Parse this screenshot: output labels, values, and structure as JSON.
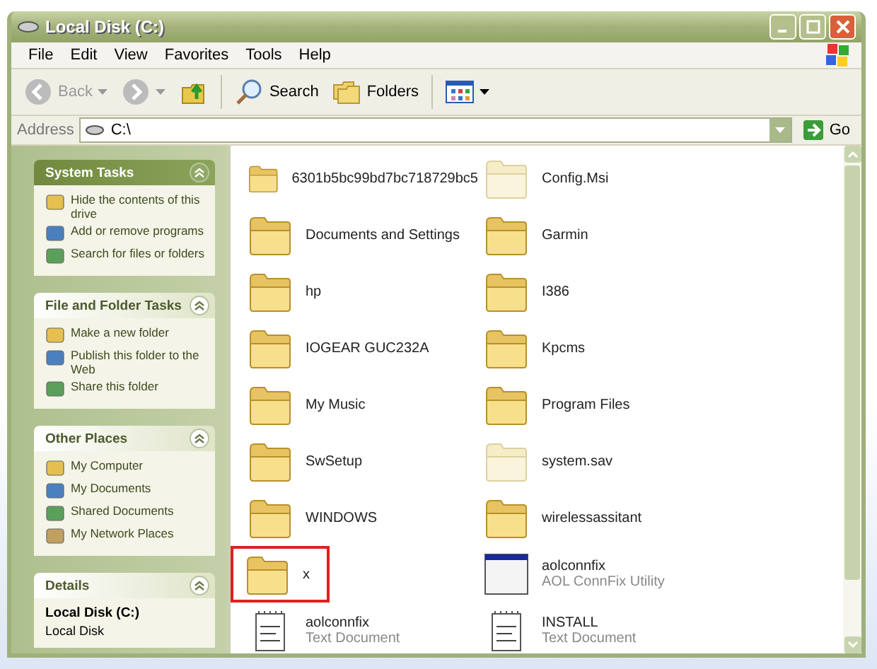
{
  "window": {
    "title": "Local Disk (C:)"
  },
  "menu": [
    "File",
    "Edit",
    "View",
    "Favorites",
    "Tools",
    "Help"
  ],
  "toolbar": {
    "back": {
      "label": "Back",
      "disabled": true
    },
    "forward": {
      "disabled": true
    },
    "search": "Search",
    "folders": "Folders"
  },
  "address": {
    "label": "Address",
    "value": "C:\\",
    "go": "Go"
  },
  "sidebar": [
    {
      "title": "System Tasks",
      "primary": true,
      "kind": "links",
      "links": [
        "Hide the contents of this drive",
        "Add or remove programs",
        "Search for files or folders"
      ]
    },
    {
      "title": "File and Folder Tasks",
      "primary": false,
      "kind": "links",
      "links": [
        "Make a new folder",
        "Publish this folder to the Web",
        "Share this folder"
      ]
    },
    {
      "title": "Other Places",
      "primary": false,
      "kind": "links",
      "links": [
        "My Computer",
        "My Documents",
        "Shared Documents",
        "My Network Places"
      ]
    },
    {
      "title": "Details",
      "primary": false,
      "kind": "details",
      "name": "Local Disk (C:)",
      "type": "Local Disk"
    }
  ],
  "files": [
    {
      "name": "6301b5bc99bd7bc718729bc5",
      "kind": "folder",
      "hidden": false,
      "highlighted": false
    },
    {
      "name": "Config.Msi",
      "kind": "folder",
      "hidden": true,
      "highlighted": false
    },
    {
      "name": "Documents and Settings",
      "kind": "folder",
      "hidden": false,
      "highlighted": false
    },
    {
      "name": "Garmin",
      "kind": "folder",
      "hidden": false,
      "highlighted": false
    },
    {
      "name": "hp",
      "kind": "folder",
      "hidden": false,
      "highlighted": false
    },
    {
      "name": "I386",
      "kind": "folder",
      "hidden": false,
      "highlighted": false
    },
    {
      "name": "IOGEAR GUC232A",
      "kind": "folder",
      "hidden": false,
      "highlighted": false
    },
    {
      "name": "Kpcms",
      "kind": "folder",
      "hidden": false,
      "highlighted": false
    },
    {
      "name": "My Music",
      "kind": "folder",
      "hidden": false,
      "highlighted": false
    },
    {
      "name": "Program Files",
      "kind": "folder",
      "hidden": false,
      "highlighted": false
    },
    {
      "name": "SwSetup",
      "kind": "folder",
      "hidden": false,
      "highlighted": false
    },
    {
      "name": "system.sav",
      "kind": "folder",
      "hidden": true,
      "highlighted": false
    },
    {
      "name": "WINDOWS",
      "kind": "folder",
      "hidden": false,
      "highlighted": false
    },
    {
      "name": "wirelessassitant",
      "kind": "folder",
      "hidden": false,
      "highlighted": false
    },
    {
      "name": "x",
      "kind": "folder",
      "hidden": false,
      "highlighted": true
    },
    {
      "name": "aolconnfix",
      "kind": "app",
      "subtitle": "AOL ConnFix Utility"
    },
    {
      "name": "aolconnfix",
      "kind": "text",
      "subtitle": "Text Document"
    },
    {
      "name": "INSTALL",
      "kind": "text",
      "subtitle": "Text Document"
    }
  ]
}
